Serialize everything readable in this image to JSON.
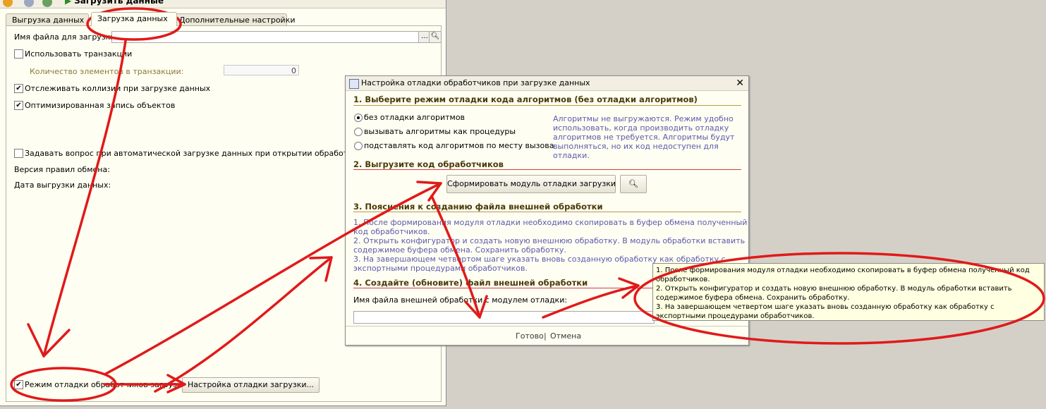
{
  "toolbar": {
    "load_button_label": "Загрузить данные"
  },
  "tabs": [
    {
      "label": "Выгрузка данных"
    },
    {
      "label": "Загрузка данных"
    },
    {
      "label": "Дополнительные настройки"
    }
  ],
  "load_tab": {
    "filename_label": "Имя файла для загрузки:",
    "filename_value": "",
    "browse_btn": "...",
    "use_transactions_label": "Использовать транзакции",
    "use_transactions_checked": false,
    "items_in_transaction_label": "Количество элементов в транзакции:",
    "items_in_transaction_value": "0",
    "track_collisions_label": "Отслеживать коллизии при загрузке данных",
    "track_collisions_checked": true,
    "optimized_write_label": "Оптимизированная запись объектов",
    "optimized_write_checked": true,
    "ask_on_autoload_label": "Задавать вопрос при автоматической загрузке данных при открытии обработки",
    "ask_on_autoload_checked": false,
    "rules_version_label": "Версия правил обмена:",
    "export_date_label": "Дата выгрузки данных:",
    "debug_mode_label": "Режим отладки обработчиков загрузки",
    "debug_mode_checked": true,
    "debug_settings_button": "Настройка отладки загрузки..."
  },
  "dialog": {
    "title": "Настройка отладки обработчиков при загрузке данных",
    "section1": "1. Выберите режим отладки кода алгоритмов (без отладки алгоритмов)",
    "radio_options": [
      {
        "label": "без отладки алгоритмов",
        "selected": true
      },
      {
        "label": "вызывать алгоритмы как процедуры",
        "selected": false
      },
      {
        "label": "подставлять код алгоритмов по месту вызова",
        "selected": false
      }
    ],
    "section1_note": [
      "Алгоритмы не выгружаются. Режим удобно",
      "использовать, когда производить отладку",
      "алгоритмов не требуется. Алгоритмы будут",
      "выполняться, но их код недоступен для отладки."
    ],
    "section2": "2. Выгрузите код обработчиков",
    "generate_button": "Сформировать модуль отладки загрузки",
    "section3": "3. Пояснения к созданию файла внешней обработки",
    "section3_lines": [
      "1. После формирования модуля отладки необходимо скопировать в буфер обмена полученный",
      "код обработчиков.",
      "2. Открыть конфигуратор и создать новую внешнюю обработку. В модуль обработки вставить",
      "содержимое буфера обмена. Сохранить обработку.",
      "3. На завершающем четвертом шаге указать вновь созданную обработку как обработку с",
      "экспортными процедурами обработчиков."
    ],
    "section4": "4. Создайте (обновите) файл внешней обработки",
    "ext_file_label": "Имя файла внешней обработки с модулем отладки:",
    "ext_file_value": "",
    "done_link": "Готово",
    "separator": "|",
    "cancel_link": "Отмена"
  },
  "tooltip_lines": [
    "1. После формирования модуля отладки необходимо скопировать в буфер обмена полученный код обработчиков.",
    "2. Открыть конфигуратор и создать новую внешнюю обработку. В модуль обработки вставить содержимое буфера обмена. Сохранить обработку.",
    "3. На завершающем четвертом шаге указать вновь созданную обработку как обработку с экспортными процедурами обработчиков."
  ],
  "annotation_color": "#e01a1a"
}
